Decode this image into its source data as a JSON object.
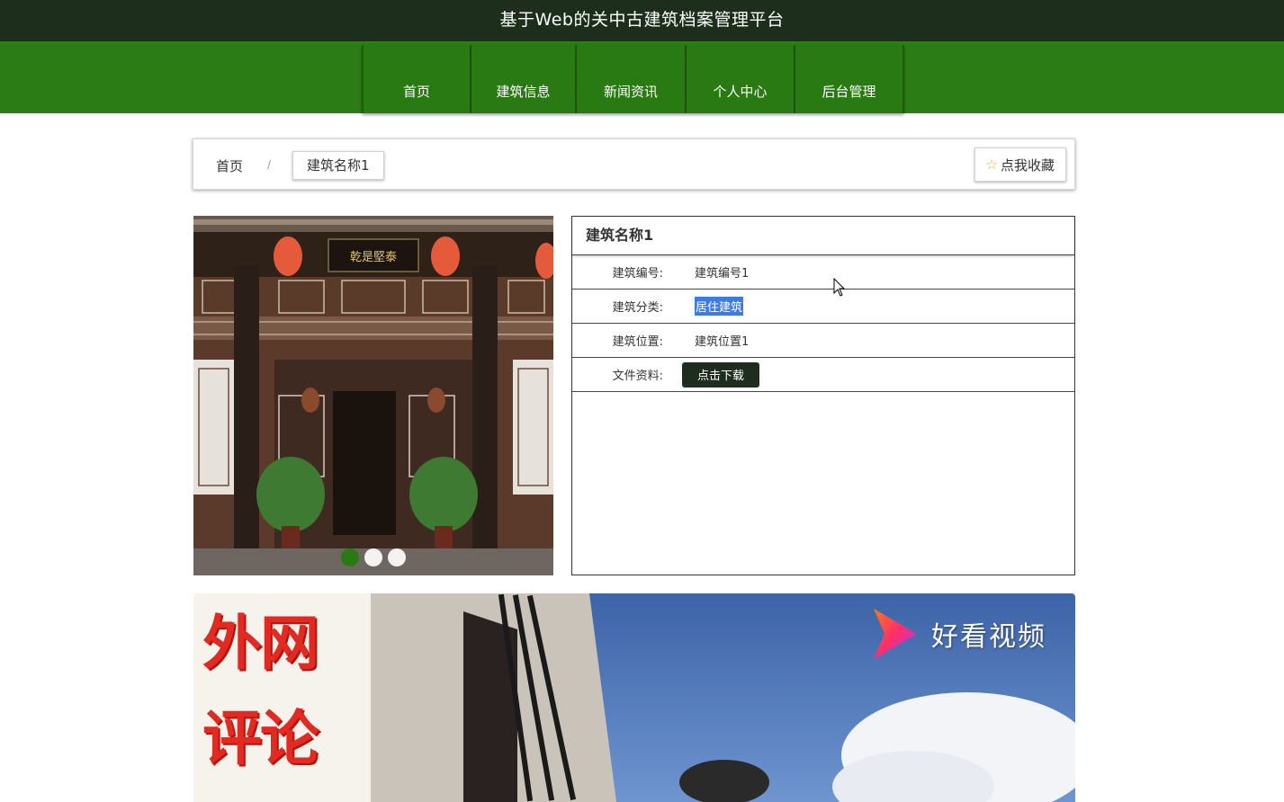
{
  "header": {
    "site_title": "基于Web的关中古建筑档案管理平台"
  },
  "nav": {
    "items": [
      {
        "label": "首页"
      },
      {
        "label": "建筑信息"
      },
      {
        "label": "新闻资讯"
      },
      {
        "label": "个人中心"
      },
      {
        "label": "后台管理"
      }
    ]
  },
  "breadcrumb": {
    "home": "首页",
    "separator": "/",
    "current": "建筑名称1"
  },
  "favorite_button": {
    "label": "点我收藏",
    "icon": "star-icon"
  },
  "carousel": {
    "slide_count": 3,
    "active_index": 0,
    "plaque_text": "乾是堅泰"
  },
  "detail": {
    "title": "建筑名称1",
    "rows": [
      {
        "label": "建筑编号:",
        "value": "建筑编号1"
      },
      {
        "label": "建筑分类:",
        "value": "居住建筑"
      },
      {
        "label": "建筑位置:",
        "value": "建筑位置1"
      },
      {
        "label": "文件资料:",
        "button": "点击下载"
      }
    ]
  },
  "video": {
    "promo_line1": "外网",
    "promo_line2": "评论",
    "brand": "好看视频"
  },
  "colors": {
    "title_bar": "#1d2e1d",
    "nav_bar": "#2b7c14",
    "download_button": "#1e2d1e",
    "selection": "#3b7be4",
    "promo_red": "#e02a22"
  }
}
